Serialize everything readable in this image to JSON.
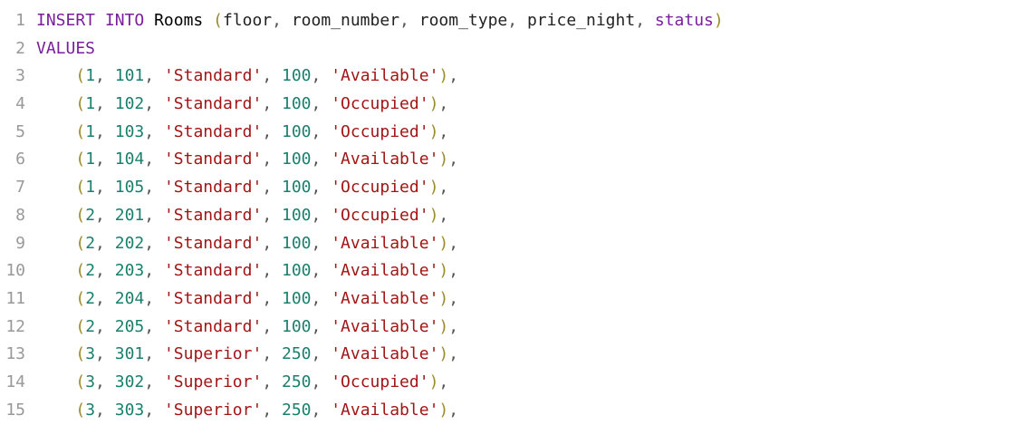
{
  "editor": {
    "header": {
      "line1": {
        "num": "1",
        "kw_insert": "INSERT",
        "kw_into": "INTO",
        "table": "Rooms",
        "open": " (",
        "c1": "floor",
        "c2": "room_number",
        "c3": "room_type",
        "c4": "price_night",
        "c5": "status",
        "close": ")"
      },
      "line2": {
        "num": "2",
        "kw_values": "VALUES"
      }
    },
    "rows": [
      {
        "num": "3",
        "floor": "1",
        "room": "101",
        "type": "'Standard'",
        "price": "100",
        "status": "'Available'"
      },
      {
        "num": "4",
        "floor": "1",
        "room": "102",
        "type": "'Standard'",
        "price": "100",
        "status": "'Occupied'"
      },
      {
        "num": "5",
        "floor": "1",
        "room": "103",
        "type": "'Standard'",
        "price": "100",
        "status": "'Occupied'"
      },
      {
        "num": "6",
        "floor": "1",
        "room": "104",
        "type": "'Standard'",
        "price": "100",
        "status": "'Available'"
      },
      {
        "num": "7",
        "floor": "1",
        "room": "105",
        "type": "'Standard'",
        "price": "100",
        "status": "'Occupied'"
      },
      {
        "num": "8",
        "floor": "2",
        "room": "201",
        "type": "'Standard'",
        "price": "100",
        "status": "'Occupied'"
      },
      {
        "num": "9",
        "floor": "2",
        "room": "202",
        "type": "'Standard'",
        "price": "100",
        "status": "'Available'"
      },
      {
        "num": "10",
        "floor": "2",
        "room": "203",
        "type": "'Standard'",
        "price": "100",
        "status": "'Available'"
      },
      {
        "num": "11",
        "floor": "2",
        "room": "204",
        "type": "'Standard'",
        "price": "100",
        "status": "'Available'"
      },
      {
        "num": "12",
        "floor": "2",
        "room": "205",
        "type": "'Standard'",
        "price": "100",
        "status": "'Available'"
      },
      {
        "num": "13",
        "floor": "3",
        "room": "301",
        "type": "'Superior'",
        "price": "250",
        "status": "'Available'"
      },
      {
        "num": "14",
        "floor": "3",
        "room": "302",
        "type": "'Superior'",
        "price": "250",
        "status": "'Occupied'"
      },
      {
        "num": "15",
        "floor": "3",
        "room": "303",
        "type": "'Superior'",
        "price": "250",
        "status": "'Available'"
      }
    ]
  },
  "colors": {
    "keyword": "#7a1f9c",
    "number": "#1a7f6e",
    "string": "#a31515",
    "line_number": "#999999"
  }
}
